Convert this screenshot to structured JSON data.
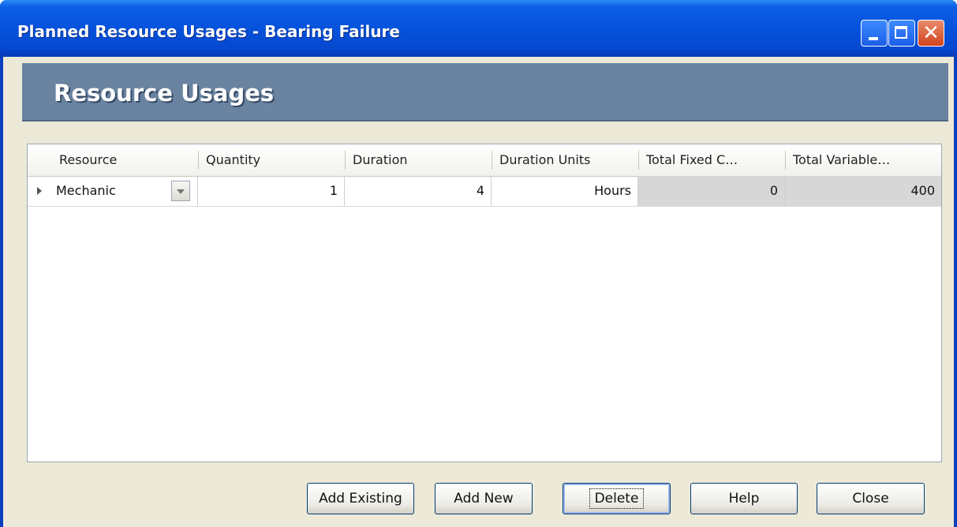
{
  "window": {
    "title": "Planned Resource Usages - Bearing Failure",
    "controls": {
      "minimize_icon": "minimize-icon",
      "maximize_icon": "maximize-icon",
      "close_icon": "close-icon",
      "close_glyph": "✕"
    }
  },
  "header": {
    "title": "Resource Usages"
  },
  "grid": {
    "columns": [
      "Resource",
      "Quantity",
      "Duration",
      "Duration Units",
      "Total Fixed C…",
      "Total Variable…"
    ],
    "rows": [
      {
        "resource": "Mechanic",
        "quantity": "1",
        "duration": "4",
        "duration_units": "Hours",
        "total_fixed": "0",
        "total_variable": "400"
      }
    ]
  },
  "buttons": {
    "add_existing": "Add Existing",
    "add_new": "Add New",
    "delete": "Delete",
    "help": "Help",
    "close": "Close"
  },
  "colors": {
    "titlebar": "#0652dc",
    "header_band": "#6983a0",
    "client_bg": "#ece9d8",
    "readonly_cell": "#d7d7d7"
  }
}
